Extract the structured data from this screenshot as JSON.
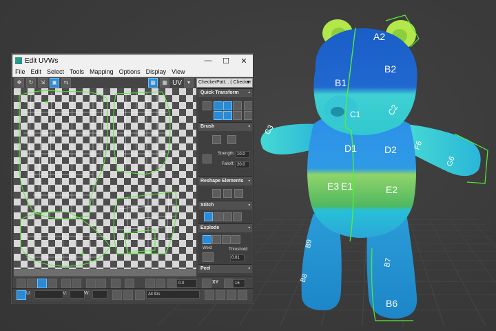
{
  "window": {
    "title": "Edit UVWs",
    "minimize": "—",
    "maximize": "☐",
    "close": "✕"
  },
  "menu": [
    "File",
    "Edit",
    "Select",
    "Tools",
    "Mapping",
    "Options",
    "Display",
    "View"
  ],
  "toolbar": {
    "uv_label": "UV",
    "map_dropdown": "CheckerPatt... ( Checker )"
  },
  "panel": {
    "quick_transform": "Quick Transform",
    "brush": "Brush",
    "strength_label": "Strength:",
    "strength_value": "10.0",
    "falloff_label": "Falloff:",
    "falloff_value": "20.0",
    "reshape": "Reshape Elements",
    "stitch": "Stitch",
    "explode": "Explode",
    "weld_label": "Weld",
    "threshold_label": "Threshold:",
    "threshold_value": "0.01",
    "peel": "Peel"
  },
  "bottom": {
    "angle_value": "0.0",
    "xy_label": "XY",
    "num_value": "16",
    "u_label": "U:",
    "v_label": "V:",
    "w_label": "W:",
    "ids_label": "All IDs"
  },
  "bear_labels": [
    "A2",
    "B2",
    "B1",
    "C1",
    "C2",
    "C3",
    "D1",
    "D2",
    "F6",
    "G6",
    "E3",
    "E1",
    "E2",
    "B6",
    "B7",
    "B9",
    "B8"
  ],
  "colors": {
    "accent": "#2a8ad8",
    "seam_green": "#55ee33"
  }
}
